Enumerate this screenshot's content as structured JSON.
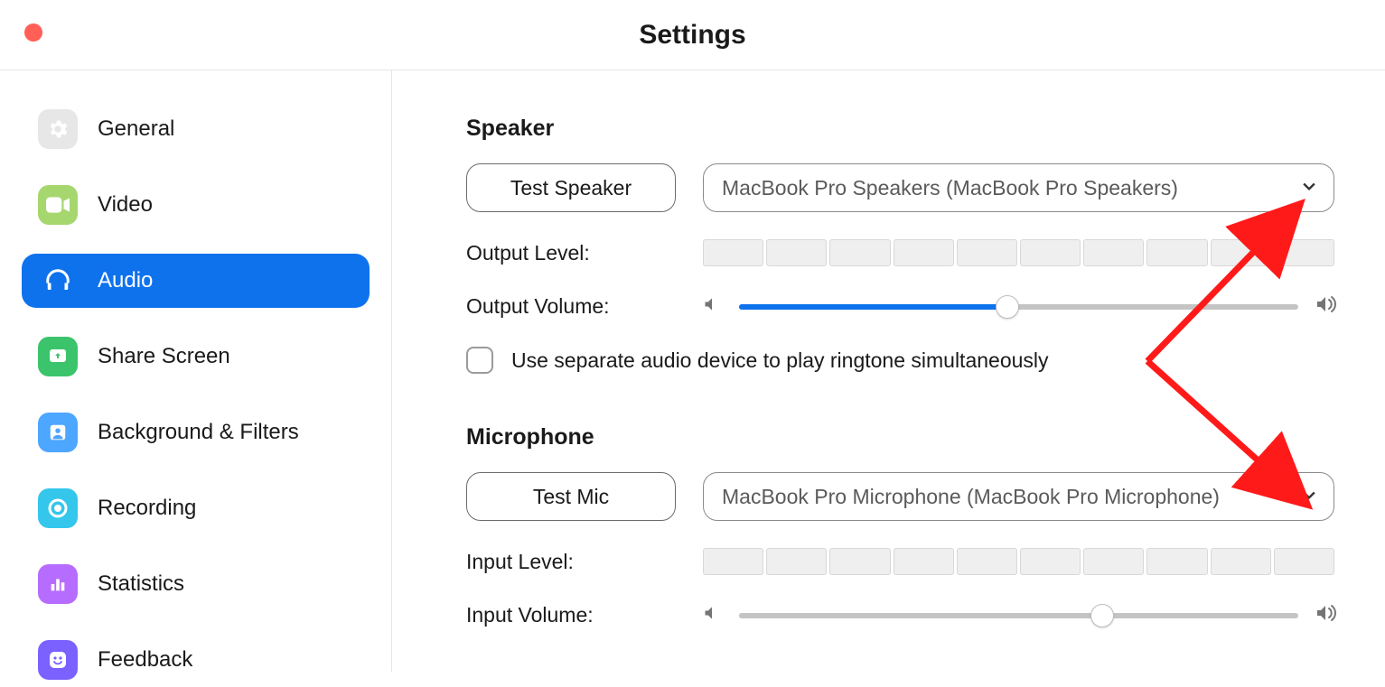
{
  "window": {
    "title": "Settings"
  },
  "sidebar": {
    "items": [
      {
        "label": "General"
      },
      {
        "label": "Video"
      },
      {
        "label": "Audio"
      },
      {
        "label": "Share Screen"
      },
      {
        "label": "Background & Filters"
      },
      {
        "label": "Recording"
      },
      {
        "label": "Statistics"
      },
      {
        "label": "Feedback"
      }
    ],
    "active_index": 2
  },
  "speaker": {
    "section_title": "Speaker",
    "test_label": "Test Speaker",
    "device": "MacBook Pro Speakers (MacBook Pro Speakers)",
    "output_level_label": "Output Level:",
    "output_volume_label": "Output Volume:",
    "volume_percent": 48,
    "separate_ringtone_label": "Use separate audio device to play ringtone simultaneously",
    "separate_ringtone_checked": false
  },
  "microphone": {
    "section_title": "Microphone",
    "test_label": "Test Mic",
    "device": "MacBook Pro Microphone (MacBook Pro Microphone)",
    "input_level_label": "Input Level:",
    "input_volume_label": "Input Volume:",
    "volume_percent": 65
  }
}
